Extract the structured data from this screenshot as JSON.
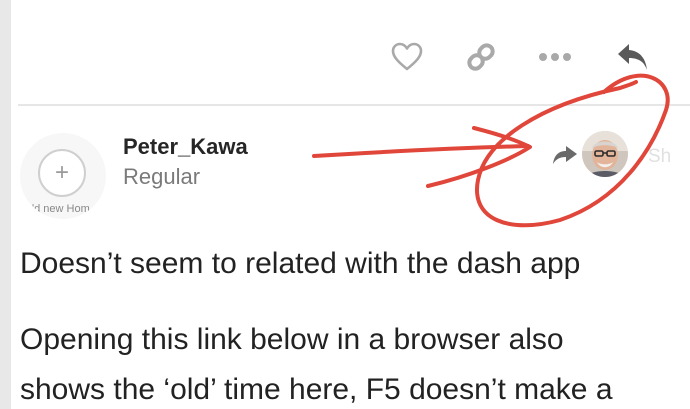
{
  "post": {
    "actions": [
      {
        "name": "like",
        "icon": "heart-icon"
      },
      {
        "name": "copy-link",
        "icon": "link-icon"
      },
      {
        "name": "more",
        "icon": "ellipsis-icon"
      },
      {
        "name": "reply",
        "icon": "reply-icon"
      }
    ],
    "avatar_placeholder": {
      "icon": "plus-icon",
      "caption": "ʹd new Hom"
    },
    "author": {
      "username": "Peter_Kawa",
      "title": "Regular"
    },
    "reply_to": {
      "icon": "reply-arrow-icon",
      "avatar": "user-avatar",
      "name_partial": "Sh"
    },
    "body": {
      "lines": [
        "Doesn’t seem to related with the dash app",
        "Opening this link below in a browser also",
        "shows the ‘old’ time here, F5 doesn’t make a"
      ]
    }
  },
  "annotation": {
    "color": "#e0463a"
  },
  "colors": {
    "icon": "#a9a9a9",
    "reply_icon": "#5a5a5a",
    "text": "#222222"
  }
}
